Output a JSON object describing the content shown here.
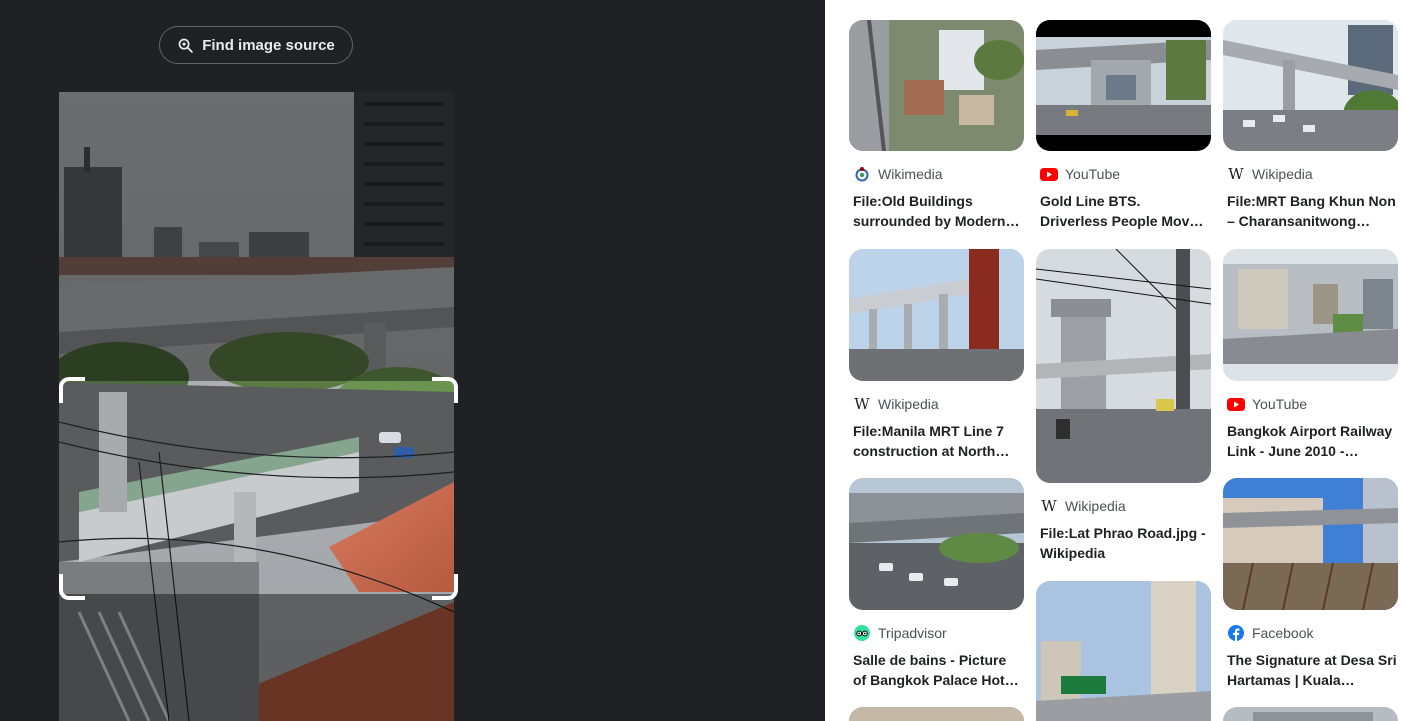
{
  "left": {
    "find_source_label": "Find image source"
  },
  "results": [
    {
      "source": "Wikimedia",
      "source_icon": "wikimedia-icon",
      "title": "File:Old Buildings surrounded by Modern…"
    },
    {
      "source": "YouTube",
      "source_icon": "youtube-icon",
      "title": "Gold Line BTS. Driverless People Mov…"
    },
    {
      "source": "Wikipedia",
      "source_icon": "wikipedia-icon",
      "title": "File:MRT Bang Khun Non – Charansanitwong…"
    },
    {
      "source": "Wikipedia",
      "source_icon": "wikipedia-icon",
      "title": "File:Manila MRT Line 7 construction at North…"
    },
    {
      "source": "Wikipedia",
      "source_icon": "wikipedia-icon",
      "title": "File:Lat Phrao Road.jpg - Wikipedia"
    },
    {
      "source": "YouTube",
      "source_icon": "youtube-icon",
      "title": "Bangkok Airport Railway Link - June 2010 -…"
    },
    {
      "source": "Tripadvisor",
      "source_icon": "tripadvisor-icon",
      "title": "Salle de bains - Picture of Bangkok Palace Hot…"
    },
    {
      "source": "Facebook",
      "source_icon": "facebook-icon",
      "title": "The Signature at Desa Sri Hartamas | Kuala…"
    }
  ],
  "colors": {
    "dark_bg": "#202124",
    "youtube_red": "#ff0000",
    "facebook_blue": "#1877f2",
    "tripadvisor_green": "#34e0a1"
  }
}
